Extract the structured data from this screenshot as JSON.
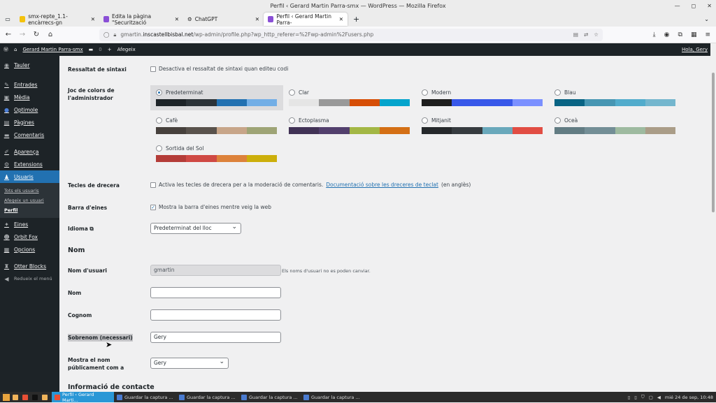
{
  "window": {
    "title": "Perfil ‹ Gerard Martin Parra-smx — WordPress — Mozilla Firefox"
  },
  "tabs": [
    {
      "label": "smx-repte_1.1-encàrrecs-gn",
      "color": "#f4c20d"
    },
    {
      "label": "Edita la pàgina \"Securització",
      "color": "#8a4fd6"
    },
    {
      "label": "ChatGPT",
      "color": "#444"
    },
    {
      "label": "Perfil ‹ Gerard Martin Parra-",
      "color": "#8a4fd6"
    }
  ],
  "url": {
    "domain_prefix": "gmartin.",
    "domain": "inscastellbisbal.net",
    "path": "/wp-admin/profile.php?wp_http_referer=%2Fwp-admin%2Fusers.php"
  },
  "adminbar": {
    "site": "Gerard Martin Parra-smx",
    "comments": "0",
    "new": "Afegeix",
    "howdy": "Hola, Gery"
  },
  "sidebar": {
    "items": [
      {
        "label": "Tauler",
        "icon": "dashboard-icon",
        "glyph": "◉"
      },
      {
        "label": "Entrades",
        "icon": "pin-icon",
        "glyph": "✎"
      },
      {
        "label": "Mèdia",
        "icon": "media-icon",
        "glyph": "▣"
      },
      {
        "label": "Optimole",
        "icon": "optimole-icon",
        "glyph": "●"
      },
      {
        "label": "Pàgines",
        "icon": "pages-icon",
        "glyph": "▤"
      },
      {
        "label": "Comentaris",
        "icon": "comments-icon",
        "glyph": "▬"
      },
      {
        "label": "Aparença",
        "icon": "appearance-icon",
        "glyph": "✐"
      },
      {
        "label": "Extensions",
        "icon": "plugins-icon",
        "glyph": "⚙"
      },
      {
        "label": "Usuaris",
        "icon": "users-icon",
        "glyph": "♟"
      }
    ],
    "submenu": [
      "Tots els usuaris",
      "Afegeix un usuari",
      "Perfil"
    ],
    "items2": [
      {
        "label": "Eines",
        "icon": "tools-icon",
        "glyph": "✦"
      },
      {
        "label": "Orbit Fox",
        "icon": "orbitfox-icon",
        "glyph": "☻"
      },
      {
        "label": "Opcions",
        "icon": "settings-icon",
        "glyph": "▦"
      },
      {
        "label": "Otter Blocks",
        "icon": "otter-icon",
        "glyph": "♜"
      }
    ],
    "collapse": "Redueix el menú"
  },
  "form": {
    "syntax": {
      "label": "Ressaltat de sintaxi",
      "text": "Desactiva el ressaltat de sintaxi quan editeu codi"
    },
    "schemes_label": "Joc de colors de l'administrador",
    "schemes": [
      {
        "name": "Predeterminat",
        "selected": true,
        "colors": [
          "#1d2327",
          "#2c3338",
          "#2271b1",
          "#72aee6"
        ]
      },
      {
        "name": "Clar",
        "colors": [
          "#e5e5e5",
          "#999999",
          "#d64e07",
          "#04a4cc"
        ]
      },
      {
        "name": "Modern",
        "colors": [
          "#1e1e1e",
          "#3858e9",
          "#3858e9",
          "#7b90ff"
        ]
      },
      {
        "name": "Blau",
        "colors": [
          "#096484",
          "#4796b3",
          "#52accc",
          "#74b6ce"
        ]
      },
      {
        "name": "Cafè",
        "colors": [
          "#46403c",
          "#59524c",
          "#c7a589",
          "#9ea476"
        ]
      },
      {
        "name": "Ectoplasma",
        "colors": [
          "#413256",
          "#523f6d",
          "#a3b745",
          "#d46f15"
        ]
      },
      {
        "name": "Mitjanit",
        "colors": [
          "#25282b",
          "#363b3f",
          "#69a8bb",
          "#e14d43"
        ]
      },
      {
        "name": "Oceà",
        "colors": [
          "#627c83",
          "#738e96",
          "#9ebaa0",
          "#aa9d88"
        ]
      },
      {
        "name": "Sortida del Sol",
        "colors": [
          "#b43c38",
          "#cf4944",
          "#dd823b",
          "#ccaf0b"
        ]
      }
    ],
    "shortcuts": {
      "label": "Tecles de drecera",
      "text": "Activa les tecles de drecera per a la moderació de comentaris.",
      "link": "Documentació sobre les dreceres de teclat",
      "suffix": "(en anglès)"
    },
    "toolbar": {
      "label": "Barra d'eines",
      "text": "Mostra la barra d'eines mentre veig la web"
    },
    "language": {
      "label": "Idioma",
      "value": "Predeterminat del lloc"
    },
    "name_heading": "Nom",
    "username": {
      "label": "Nom d'usuari",
      "value": "gmartin",
      "desc": "Els noms d'usuari no es poden canviar."
    },
    "first_name": {
      "label": "Nom",
      "value": ""
    },
    "last_name": {
      "label": "Cognom",
      "value": ""
    },
    "nickname": {
      "label": "Sobrenom (necessari)",
      "value": "Gery"
    },
    "display": {
      "label": "Mostra el nom públicament com a",
      "value": "Gery"
    },
    "contact_heading": "Informació de contacte"
  },
  "taskbar": {
    "items": [
      "Perfil ‹ Gerard Marti...",
      "Guardar la captura ...",
      "Guardar la captura ...",
      "Guardar la captura ...",
      "Guardar la captura ..."
    ],
    "clock": "mié 24 de sep, 10:48"
  }
}
